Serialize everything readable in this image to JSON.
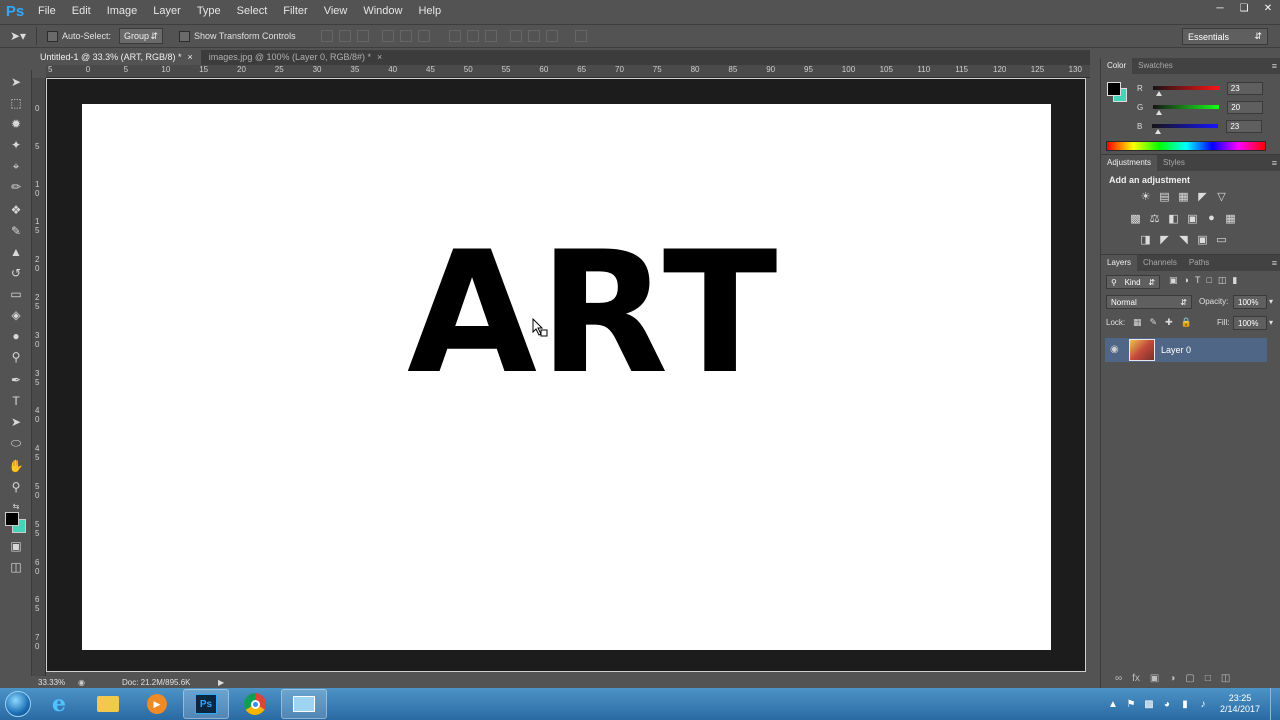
{
  "app": {
    "logo": "Ps",
    "menu": [
      "File",
      "Edit",
      "Image",
      "Layer",
      "Type",
      "Select",
      "Filter",
      "View",
      "Window",
      "Help"
    ]
  },
  "options_bar": {
    "auto_select_label": "Auto-Select:",
    "auto_select_value": "Group",
    "show_transform_label": "Show Transform Controls",
    "workspace": "Essentials"
  },
  "tabs": [
    {
      "label": "Untitled-1 @ 33.3% (ART, RGB/8) *",
      "active": true
    },
    {
      "label": "images.jpg @ 100% (Layer 0, RGB/8#) *",
      "active": false
    }
  ],
  "rulers": {
    "h": [
      "5",
      "0",
      "5",
      "10",
      "15",
      "20",
      "25",
      "30",
      "35",
      "40",
      "45",
      "50",
      "55",
      "60",
      "65",
      "70",
      "75",
      "80",
      "85",
      "90",
      "95",
      "100",
      "105",
      "110",
      "115",
      "120",
      "125",
      "130"
    ],
    "v": [
      "0",
      "5",
      "1 0",
      "1 5",
      "2 0",
      "2 5",
      "3 0",
      "3 5",
      "4 0",
      "4 5",
      "5 0",
      "5 5",
      "6 0",
      "6 5",
      "7 0"
    ]
  },
  "canvas": {
    "text": "ART"
  },
  "status": {
    "zoom": "33.33%",
    "doc": "Doc: 21.2M/895.6K"
  },
  "color_panel": {
    "tabs": [
      "Color",
      "Swatches"
    ],
    "r_label": "R",
    "r": "23",
    "g_label": "G",
    "g": "20",
    "b_label": "B",
    "b": "23",
    "fg_color": "#000000",
    "bg_color": "#46d4b8"
  },
  "adjustments_panel": {
    "tabs": [
      "Adjustments",
      "Styles"
    ],
    "heading": "Add an adjustment"
  },
  "layers_panel": {
    "tabs": [
      "Layers",
      "Channels",
      "Paths"
    ],
    "kind": "Kind",
    "blend_mode": "Normal",
    "opacity_label": "Opacity:",
    "opacity": "100%",
    "lock_label": "Lock:",
    "fill_label": "Fill:",
    "fill": "100%",
    "layers": [
      {
        "name": "Layer 0"
      }
    ]
  },
  "taskbar": {
    "time": "23:25",
    "date": "2/14/2017"
  }
}
